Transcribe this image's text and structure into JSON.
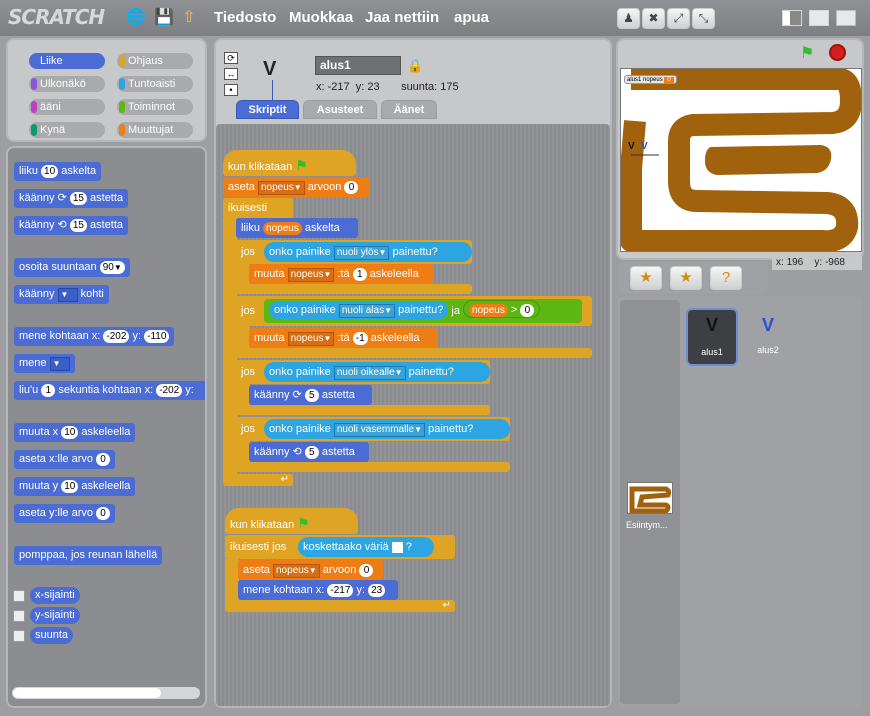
{
  "app": {
    "logo": "SCRATCH"
  },
  "menu": {
    "file": "Tiedosto",
    "edit": "Muokkaa",
    "share": "Jaa nettiin",
    "help": "apua"
  },
  "categories": [
    {
      "label": "Liike",
      "color": "#4a6cd4",
      "selected": true
    },
    {
      "label": "Ulkonäkö",
      "color": "#8a55d7"
    },
    {
      "label": "ääni",
      "color": "#bb42c3"
    },
    {
      "label": "Kynä",
      "color": "#0e9a6c"
    },
    {
      "label": "Ohjaus",
      "color": "#e0a424"
    },
    {
      "label": "Tuntoaisti",
      "color": "#2ca5e2"
    },
    {
      "label": "Toiminnot",
      "color": "#5cb712"
    },
    {
      "label": "Muuttujat",
      "color": "#ee7d16"
    }
  ],
  "palette": {
    "move": {
      "a": "liiku",
      "n": "10",
      "b": "askelta"
    },
    "turn_right": {
      "a": "käänny",
      "n": "15",
      "b": "astetta"
    },
    "turn_left": {
      "a": "käänny",
      "n": "15",
      "b": "astetta"
    },
    "point_dir": {
      "a": "osoita suuntaan",
      "n": "90"
    },
    "point_towards": {
      "a": "käänny",
      "b": "kohti"
    },
    "goto_xy": {
      "a": "mene kohtaan x:",
      "x": "-202",
      "y_label": "y:",
      "y": "-110"
    },
    "goto": {
      "a": "mene"
    },
    "glide": {
      "a": "liu'u",
      "n": "1",
      "b": "sekuntia kohtaan x:",
      "x": "-202",
      "y_label": "y:"
    },
    "change_x": {
      "a": "muuta x",
      "n": "10",
      "b": "askeleella"
    },
    "set_x": {
      "a": "aseta x:lle arvo",
      "n": "0"
    },
    "change_y": {
      "a": "muuta y",
      "n": "10",
      "b": "askeleella"
    },
    "set_y": {
      "a": "aseta y:lle arvo",
      "n": "0"
    },
    "bounce": "pomppaa, jos reunan lähellä",
    "x_pos": "x-sijainti",
    "y_pos": "y-sijainti",
    "direction": "suunta"
  },
  "sprite_info": {
    "name": "alus1",
    "x_label": "x:",
    "x": "-217",
    "y_label": "y:",
    "y": "23",
    "dir_label": "suunta:",
    "dir": "175"
  },
  "tabs": [
    {
      "label": "Skriptit",
      "selected": true
    },
    {
      "label": "Asusteet"
    },
    {
      "label": "Äänet"
    }
  ],
  "script1": {
    "hat": "kun klikataan",
    "set1": {
      "a": "aseta",
      "var": "nopeus",
      "b": "arvoon",
      "n": "0"
    },
    "forever": "ikuisesti",
    "move": {
      "a": "liiku",
      "var": "nopeus",
      "b": "askelta"
    },
    "if": "jos",
    "and": "ja",
    "key_pressed_a": "onko painike",
    "key_pressed_b": "painettu?",
    "key_up": "nuoli ylös",
    "key_down": "nuoli alas",
    "key_right": "nuoli oikealle",
    "key_left": "nuoli vasemmalle",
    "change1": {
      "a": "muuta",
      "var": "nopeus",
      "b": ":tä",
      "n": "1",
      "c": "askeleella"
    },
    "gt": {
      "var": "nopeus",
      "op": ">",
      "n": "0"
    },
    "change2": {
      "a": "muuta",
      "var": "nopeus",
      "b": ":tä",
      "n": "-1",
      "c": "askeleella"
    },
    "turn_r": {
      "a": "käänny",
      "n": "5",
      "b": "astetta"
    },
    "turn_l": {
      "a": "käänny",
      "n": "5",
      "b": "astetta"
    }
  },
  "script2": {
    "hat": "kun klikataan",
    "forever_if": "ikuisesti jos",
    "touching": "koskettaako väriä",
    "q": "?",
    "set": {
      "a": "aseta",
      "var": "nopeus",
      "b": "arvoon",
      "n": "0"
    },
    "goto": {
      "a": "mene kohtaan x:",
      "x": "-217",
      "y_label": "y:",
      "y": "23"
    }
  },
  "stage": {
    "monitor": "alus1 nopeus",
    "monitor_value": "0",
    "sprite1": "V",
    "sprite2": "V",
    "mouse_x_label": "x:",
    "mouse_x": "196",
    "mouse_y_label": "y:",
    "mouse_y": "-968"
  },
  "sprites": [
    {
      "name": "alus1",
      "glyph": "V",
      "selected": true
    },
    {
      "name": "alus2",
      "glyph": "V"
    }
  ],
  "stage_thumb": {
    "label": "Esiintym..."
  },
  "colors": {
    "motion": "#4a6cd4",
    "control": "#e0a424",
    "sensing": "#2ca5e2",
    "operators": "#5cb712",
    "variables": "#ee7d16",
    "track": "#a0620d"
  }
}
